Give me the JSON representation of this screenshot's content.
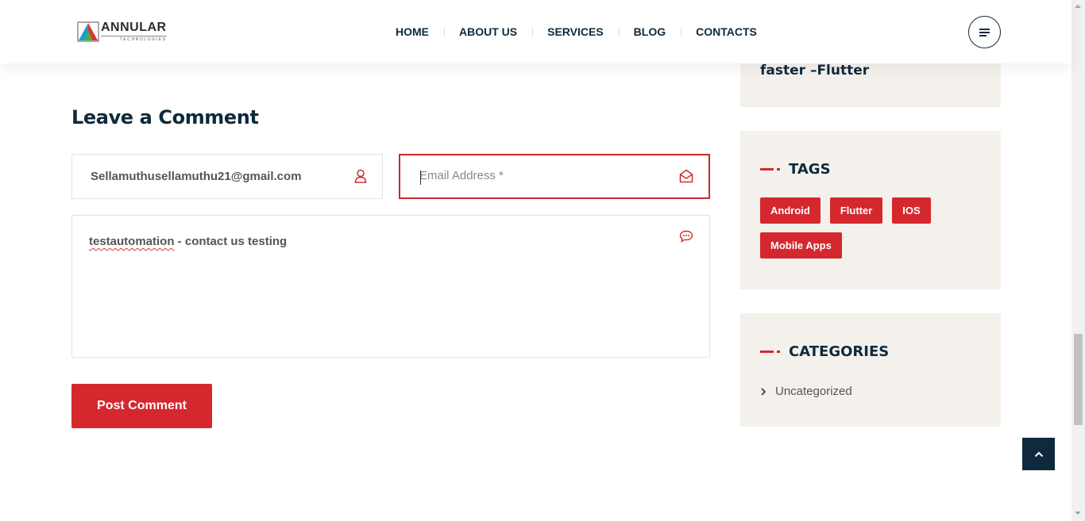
{
  "header": {
    "logo_name": "ANNULAR",
    "logo_sub": "TECHNOLOGIES",
    "nav": [
      {
        "label": "HOME"
      },
      {
        "label": "ABOUT US"
      },
      {
        "label": "SERVICES"
      },
      {
        "label": "BLOG"
      },
      {
        "label": "CONTACTS"
      }
    ],
    "menu_icon": "hamburger-icon"
  },
  "comment_form": {
    "title": "Leave a Comment",
    "name_value": "Sellamuthusellamuthu21@gmail.com",
    "email_placeholder": "Email Address *",
    "email_value": "",
    "message_word1": "testautomation",
    "message_rest": " - contact us testing",
    "submit_label": "Post Comment",
    "icons": {
      "name": "user-icon",
      "email": "envelope-open-icon",
      "message": "chat-bubble-icon"
    }
  },
  "sidebar": {
    "recent_post_tail": "faster –Flutter",
    "tags_title": "TAGS",
    "tags": [
      {
        "label": "Android"
      },
      {
        "label": "Flutter"
      },
      {
        "label": "IOS"
      },
      {
        "label": "Mobile Apps"
      }
    ],
    "categories_title": "CATEGORIES",
    "categories": [
      {
        "label": "Uncategorized"
      }
    ]
  },
  "colors": {
    "accent": "#d5282e",
    "navy": "#0e2a3c",
    "sidebar_bg": "#f4f1ec"
  },
  "scroll_to_top_icon": "chevron-up-icon"
}
